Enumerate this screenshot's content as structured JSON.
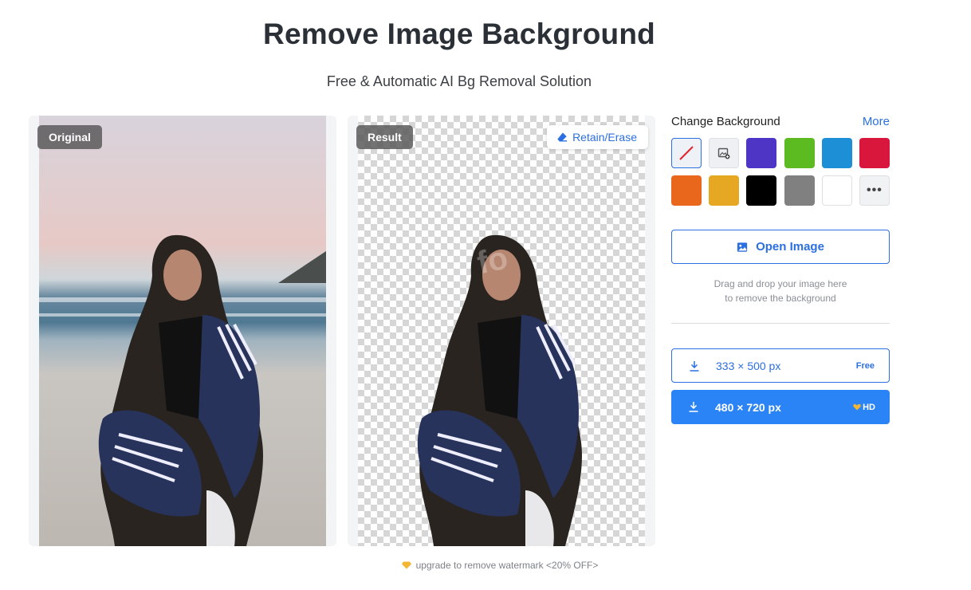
{
  "header": {
    "title": "Remove Image Background",
    "subtitle": "Free & Automatic AI Bg Removal Solution"
  },
  "original_panel": {
    "tag": "Original"
  },
  "result_panel": {
    "tag": "Result",
    "retain_erase_label": "Retain/Erase",
    "watermark": "fo"
  },
  "sidebar": {
    "title": "Change Background",
    "more_label": "More",
    "swatches": [
      {
        "name": "none",
        "icon": "no-color-icon"
      },
      {
        "name": "image",
        "icon": "add-image-icon"
      },
      {
        "name": "purple",
        "color": "#4f35c6"
      },
      {
        "name": "green",
        "color": "#5cbb20"
      },
      {
        "name": "blue",
        "color": "#1c8fd7"
      },
      {
        "name": "red",
        "color": "#d9163c"
      },
      {
        "name": "orange",
        "color": "#e8671c"
      },
      {
        "name": "yellow",
        "color": "#e6a823"
      },
      {
        "name": "black",
        "color": "#000000"
      },
      {
        "name": "gray",
        "color": "#808080"
      },
      {
        "name": "white",
        "color": "#ffffff"
      },
      {
        "name": "more",
        "label": "•••"
      }
    ],
    "open_image_label": "Open Image",
    "hint_line1": "Drag and drop your image here",
    "hint_line2": "to remove the background",
    "downloads": [
      {
        "size": "333 × 500 px",
        "badge": "Free"
      },
      {
        "size": "480 × 720 px",
        "badge": "HD"
      }
    ]
  },
  "footer": {
    "upgrade_text": "upgrade to remove watermark <20% OFF>"
  },
  "colors": {
    "accent": "#2b6fe0",
    "hd_button": "#2b84f6",
    "gem": "#f2b632"
  }
}
